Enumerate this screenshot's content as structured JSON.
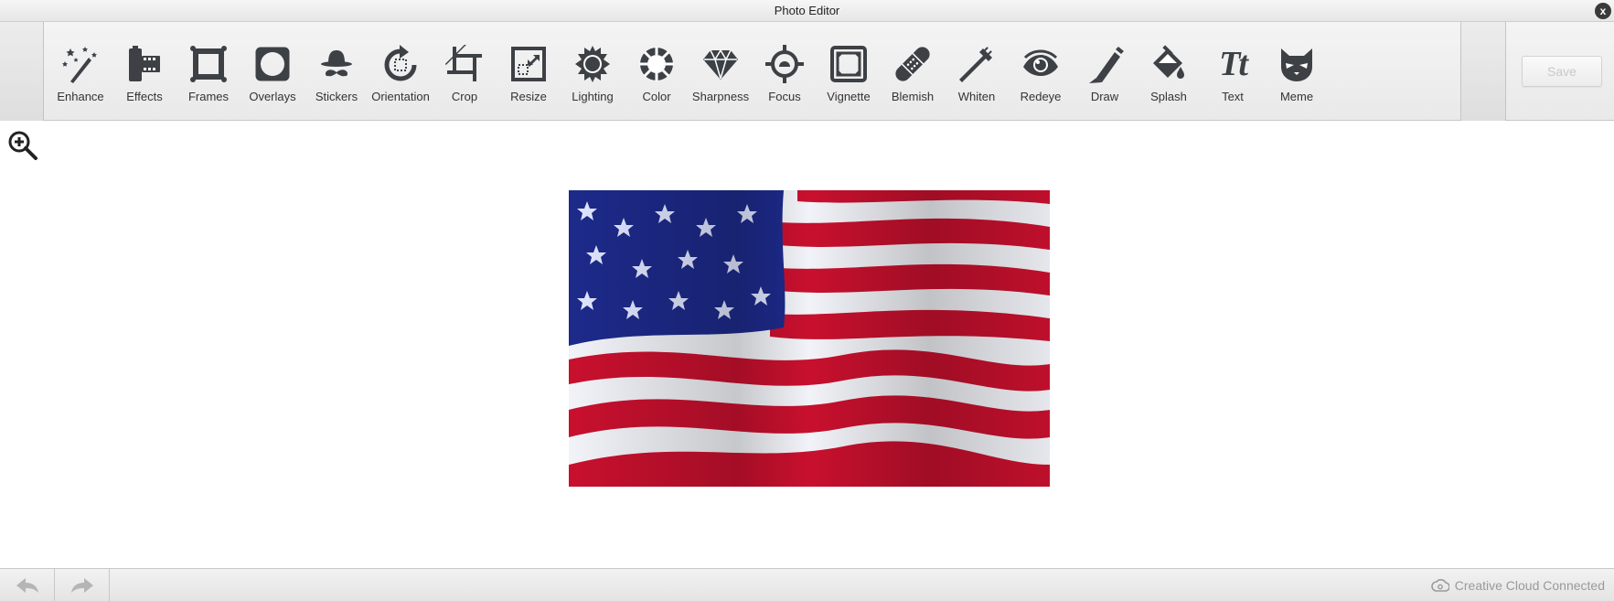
{
  "window": {
    "title": "Photo Editor",
    "close_label": "x"
  },
  "toolbar": {
    "tools": [
      {
        "label": "Enhance",
        "icon": "magic-wand-icon"
      },
      {
        "label": "Effects",
        "icon": "film-icon"
      },
      {
        "label": "Frames",
        "icon": "frame-icon"
      },
      {
        "label": "Overlays",
        "icon": "overlay-icon"
      },
      {
        "label": "Stickers",
        "icon": "hat-mustache-icon"
      },
      {
        "label": "Orientation",
        "icon": "rotate-icon"
      },
      {
        "label": "Crop",
        "icon": "crop-icon"
      },
      {
        "label": "Resize",
        "icon": "resize-icon"
      },
      {
        "label": "Lighting",
        "icon": "sun-icon"
      },
      {
        "label": "Color",
        "icon": "color-wheel-icon"
      },
      {
        "label": "Sharpness",
        "icon": "diamond-icon"
      },
      {
        "label": "Focus",
        "icon": "target-icon"
      },
      {
        "label": "Vignette",
        "icon": "vignette-icon"
      },
      {
        "label": "Blemish",
        "icon": "bandage-icon"
      },
      {
        "label": "Whiten",
        "icon": "toothbrush-icon"
      },
      {
        "label": "Redeye",
        "icon": "eye-icon"
      },
      {
        "label": "Draw",
        "icon": "pencil-icon"
      },
      {
        "label": "Splash",
        "icon": "paint-bucket-icon"
      },
      {
        "label": "Text",
        "icon": "text-icon",
        "glyph": "Tt"
      },
      {
        "label": "Meme",
        "icon": "cat-icon"
      }
    ],
    "save_label": "Save"
  },
  "footer": {
    "status": "Creative Cloud Connected"
  },
  "colors": {
    "icon": "#3d4145",
    "flag_red": "#c8102e",
    "flag_blue": "#1d2a8a"
  }
}
